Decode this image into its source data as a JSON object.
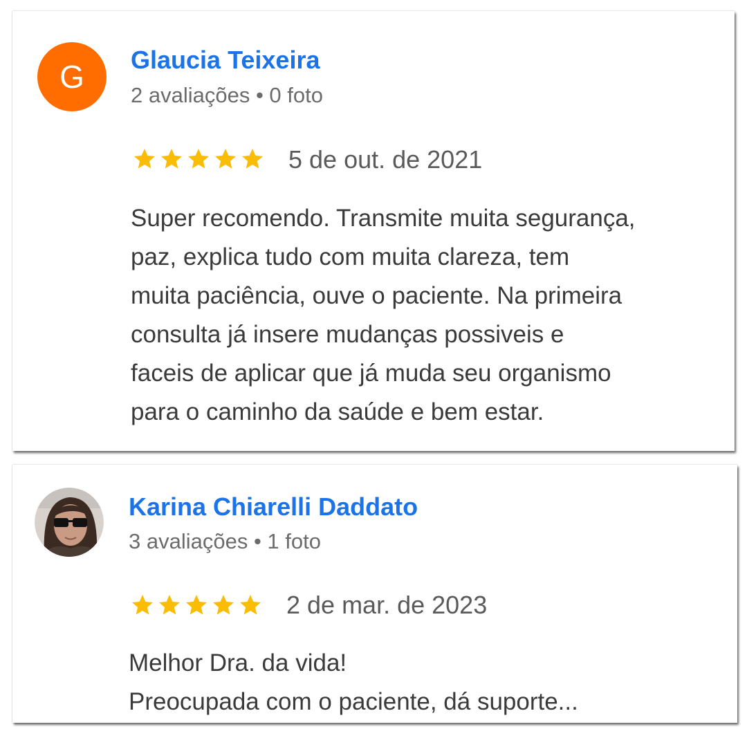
{
  "colors": {
    "name_link": "#1a73e8",
    "star": "#fbbc04",
    "avatar_g_bg": "#ff6d00"
  },
  "reviews": [
    {
      "avatar_letter": "G",
      "reviewer_name": "Glaucia Teixeira",
      "stats": "2 avaliações • 0 foto",
      "rating": 5,
      "date": "5 de out. de 2021",
      "text": "Super recomendo. Transmite muita segurança,\npaz, explica tudo com muita clareza, tem\nmuita paciência, ouve o paciente. Na primeira\nconsulta já insere mudanças possiveis e\nfaceis de aplicar que já muda seu organismo\npara o caminho da saúde e bem estar."
    },
    {
      "avatar_icon": "user-photo-sunglasses",
      "reviewer_name": "Karina Chiarelli Daddato",
      "stats": "3 avaliações • 1 foto",
      "rating": 5,
      "date": "2 de mar. de 2023",
      "text": "Melhor Dra. da vida!\nPreocupada com o paciente, dá suporte..."
    }
  ]
}
